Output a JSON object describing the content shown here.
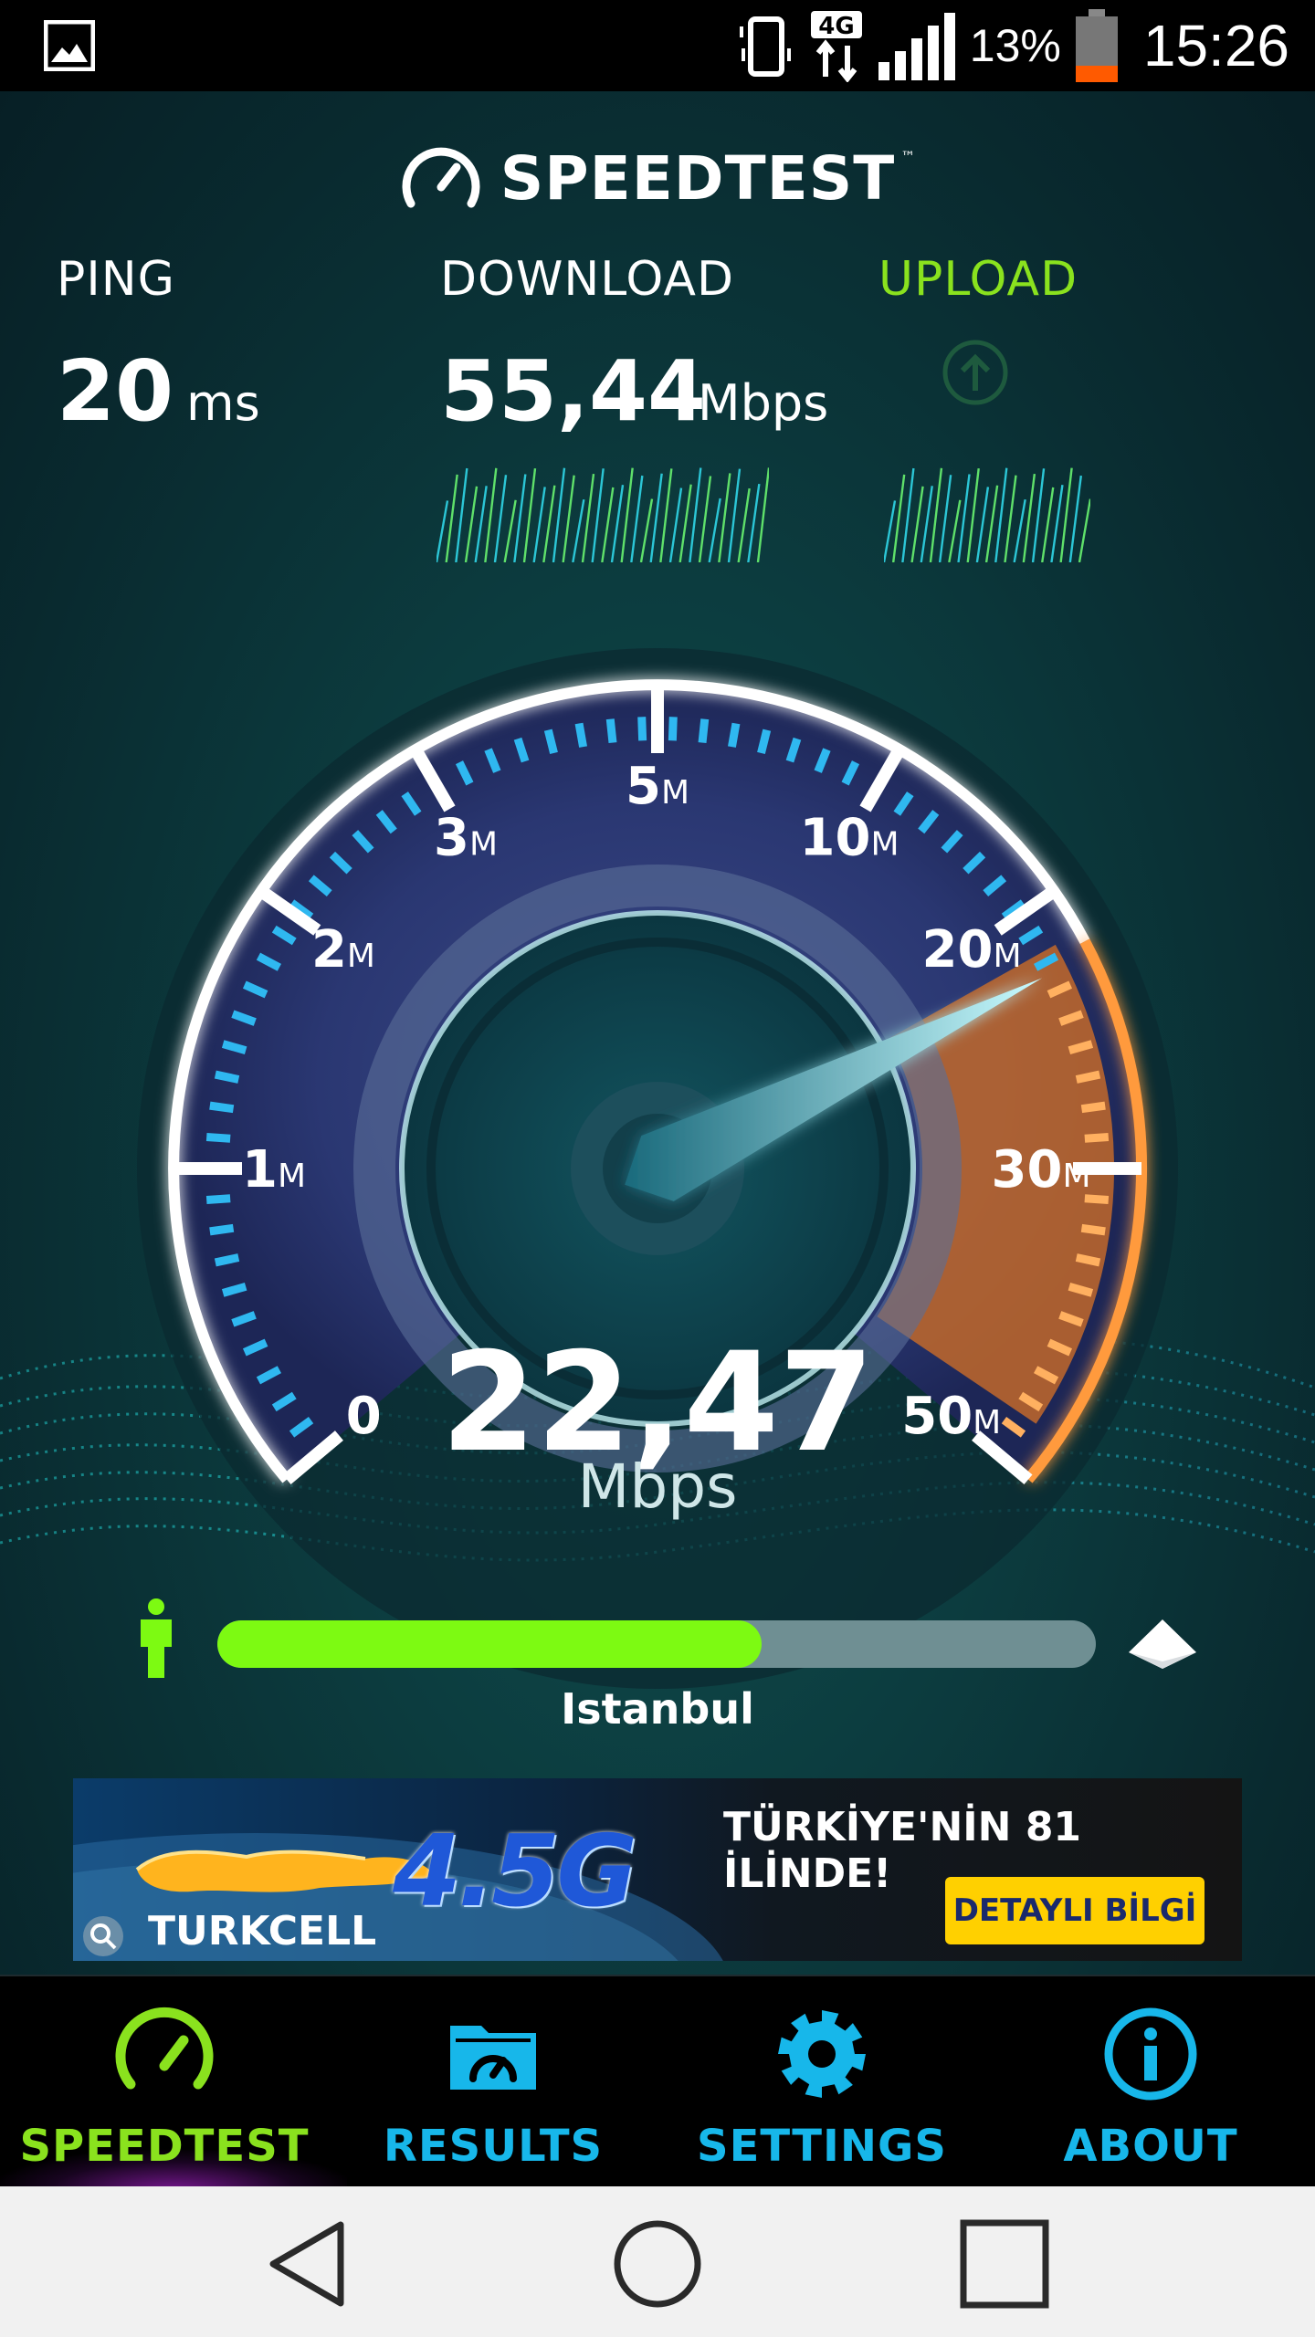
{
  "status_bar": {
    "battery_percent": "13%",
    "time": "15:26",
    "network": "4G",
    "icons": [
      "gallery-icon",
      "vibrate-icon",
      "4g-data-icon",
      "signal-icon",
      "battery-icon"
    ]
  },
  "app": {
    "logo_text": "SPEEDTEST",
    "logo_tm": "™"
  },
  "metrics": {
    "ping": {
      "label": "PING",
      "value": "20",
      "unit": "ms"
    },
    "download": {
      "label": "DOWNLOAD",
      "value": "55,44",
      "unit": "Mbps"
    },
    "upload": {
      "label": "UPLOAD",
      "label_color": "#8ae21e"
    }
  },
  "gauge": {
    "ticks": [
      {
        "num": "0",
        "unit": ""
      },
      {
        "num": "1",
        "unit": "M"
      },
      {
        "num": "2",
        "unit": "M"
      },
      {
        "num": "3",
        "unit": "M"
      },
      {
        "num": "5",
        "unit": "M"
      },
      {
        "num": "10",
        "unit": "M"
      },
      {
        "num": "20",
        "unit": "M"
      },
      {
        "num": "30",
        "unit": "M"
      },
      {
        "num": "50",
        "unit": "M"
      }
    ],
    "current_value": "22,47",
    "current_unit": "Mbps",
    "needle_value": 22.47
  },
  "progress": {
    "fraction": 0.62,
    "server": "Istanbul",
    "fill_color": "#7dfa12"
  },
  "ad": {
    "brand": "TURKCELL",
    "product": "4.5G",
    "tagline": "TÜRKİYE'NİN 81 İLİNDE!",
    "button": "DETAYLI BİLGİ"
  },
  "nav": {
    "items": [
      {
        "label": "SPEEDTEST",
        "icon": "speedometer-icon",
        "active": true,
        "color": "#8ae21e"
      },
      {
        "label": "RESULTS",
        "icon": "results-folder-icon",
        "active": false,
        "color": "#17b7ea"
      },
      {
        "label": "SETTINGS",
        "icon": "gear-icon",
        "active": false,
        "color": "#17b7ea"
      },
      {
        "label": "ABOUT",
        "icon": "info-icon",
        "active": false,
        "color": "#17b7ea"
      }
    ]
  },
  "system_nav": [
    "back-icon",
    "home-icon",
    "recents-icon"
  ]
}
